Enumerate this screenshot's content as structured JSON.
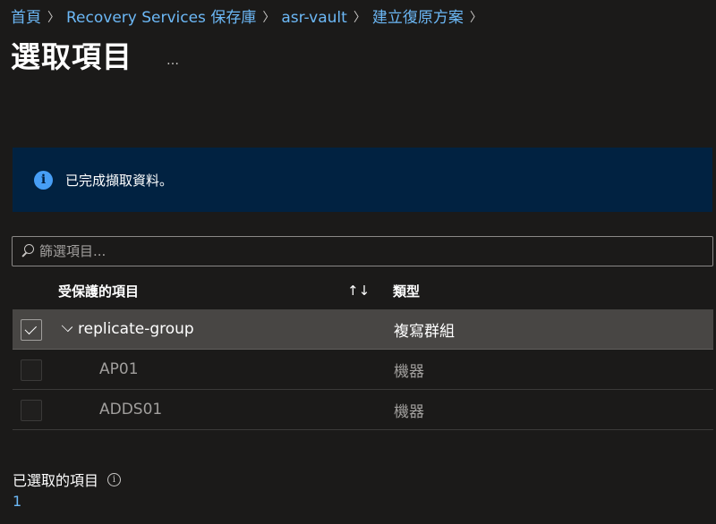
{
  "breadcrumb": {
    "items": [
      "首頁",
      "Recovery Services 保存庫",
      "asr-vault",
      "建立復原方案"
    ],
    "separator": "〉"
  },
  "page": {
    "title": "選取項目",
    "more_label": "…"
  },
  "info_banner": {
    "icon": "info-icon",
    "icon_glyph": "i",
    "text": "已完成擷取資料。"
  },
  "filter": {
    "placeholder": "篩選項目...",
    "value": ""
  },
  "table": {
    "columns": {
      "name": "受保護的項目",
      "sort": "↑↓",
      "type": "類型"
    },
    "rows": [
      {
        "name": "replicate-group",
        "type": "複寫群組",
        "checked": true,
        "expanded": true
      },
      {
        "name": "AP01",
        "type": "機器",
        "checked": false
      },
      {
        "name": "ADDS01",
        "type": "機器",
        "checked": false
      }
    ]
  },
  "selected_summary": {
    "label": "已選取的項目",
    "info_glyph": "i",
    "count": "1"
  },
  "colors": {
    "background": "#1b1a19",
    "link": "#6cb8f6",
    "info_banner_bg": "#012241",
    "info_icon": "#479ef5",
    "selected_row": "#484644"
  }
}
